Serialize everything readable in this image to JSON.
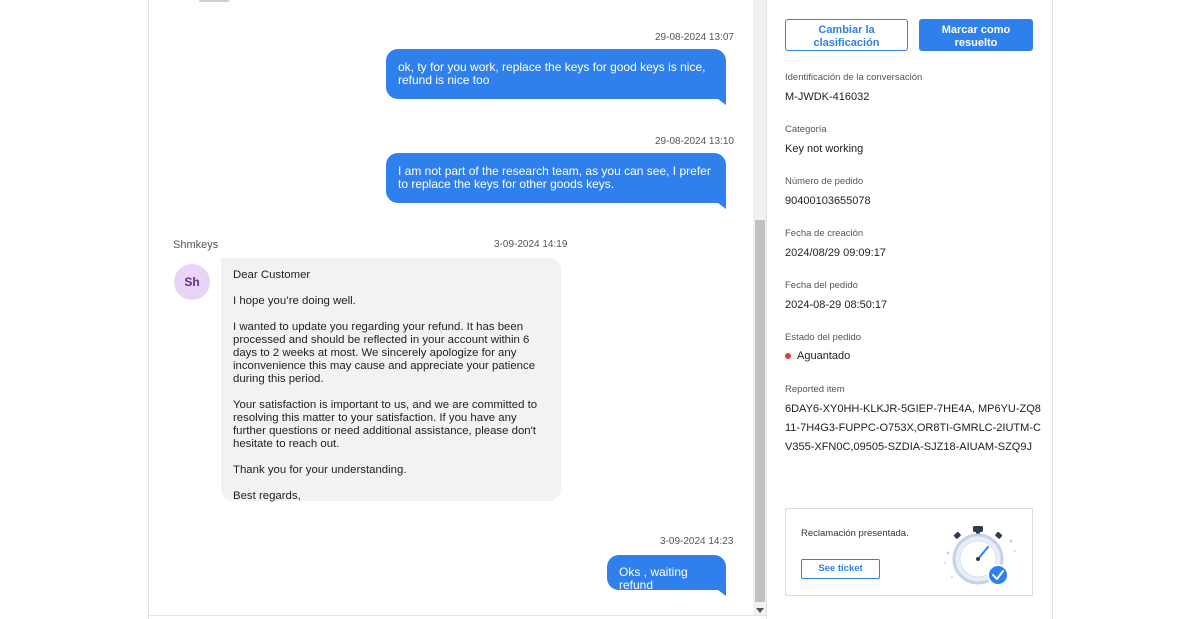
{
  "chat": {
    "messages": [
      {
        "timestamp": "29-08-2024 13:07",
        "text": "ok, ty for you work, replace the keys for good keys is nice, refund is nice too"
      },
      {
        "timestamp": "29-08-2024 13:10",
        "text": "I am not part of the research team, as you can see, I prefer to replace the keys for other goods keys."
      },
      {
        "timestamp": "3-09-2024 14:23",
        "text": "Oks , waiting refund"
      }
    ],
    "incoming": {
      "sender": "Shmkeys",
      "avatar_initials": "Sh",
      "timestamp": "3-09-2024 14:19",
      "paragraphs": [
        "Dear Customer",
        "I hope you’re doing well.",
        "I wanted to update you regarding your refund. It has been processed and should be reflected in your account within 6 days to 2 weeks at most. We sincerely apologize for any inconvenience this may cause and appreciate your patience during this period.",
        "Your satisfaction is important to us, and we are committed to resolving this matter to your satisfaction. If you have any further questions or need additional assistance, please don't hesitate to reach out.",
        "Thank you for your understanding.",
        "Best regards,"
      ]
    }
  },
  "sidebar": {
    "change_classification_label": "Cambiar la clasificación",
    "mark_resolved_label": "Marcar como resuelto",
    "fields": {
      "conversation_id": {
        "label": "Identificación de la conversación",
        "value": "M-JWDK-416032"
      },
      "category": {
        "label": "Categoría",
        "value": "Key not working"
      },
      "order_number": {
        "label": "Número de pedido",
        "value": "90400103655078"
      },
      "creation_date": {
        "label": "Fecha de creación",
        "value": "2024/08/29 09:09:17"
      },
      "order_date": {
        "label": "Fecha del pedido",
        "value": "2024-08-29 08:50:17"
      },
      "order_status": {
        "label": "Estado del pedido",
        "value": "Aguantado",
        "dot_color": "#e53935"
      },
      "reported_item": {
        "label": "Reported item",
        "value": "6DAY6-XY0HH-KLKJR-5GIEP-7HE4A, MP6YU-ZQ811-7H4G3-FUPPC-O753X,OR8TI-GMRLC-2IUTM-CV355-XFN0C,09505-SZDIA-SJZ18-AIUAM-SZQ9J"
      }
    },
    "claim": {
      "text": "Reclamación presentada.",
      "button_label": "See ticket",
      "icon": "stopwatch-check-icon"
    }
  },
  "colors": {
    "accent": "#2f80ed",
    "incoming_bubble": "#f2f2f2",
    "avatar_bg": "#ead4f5"
  }
}
